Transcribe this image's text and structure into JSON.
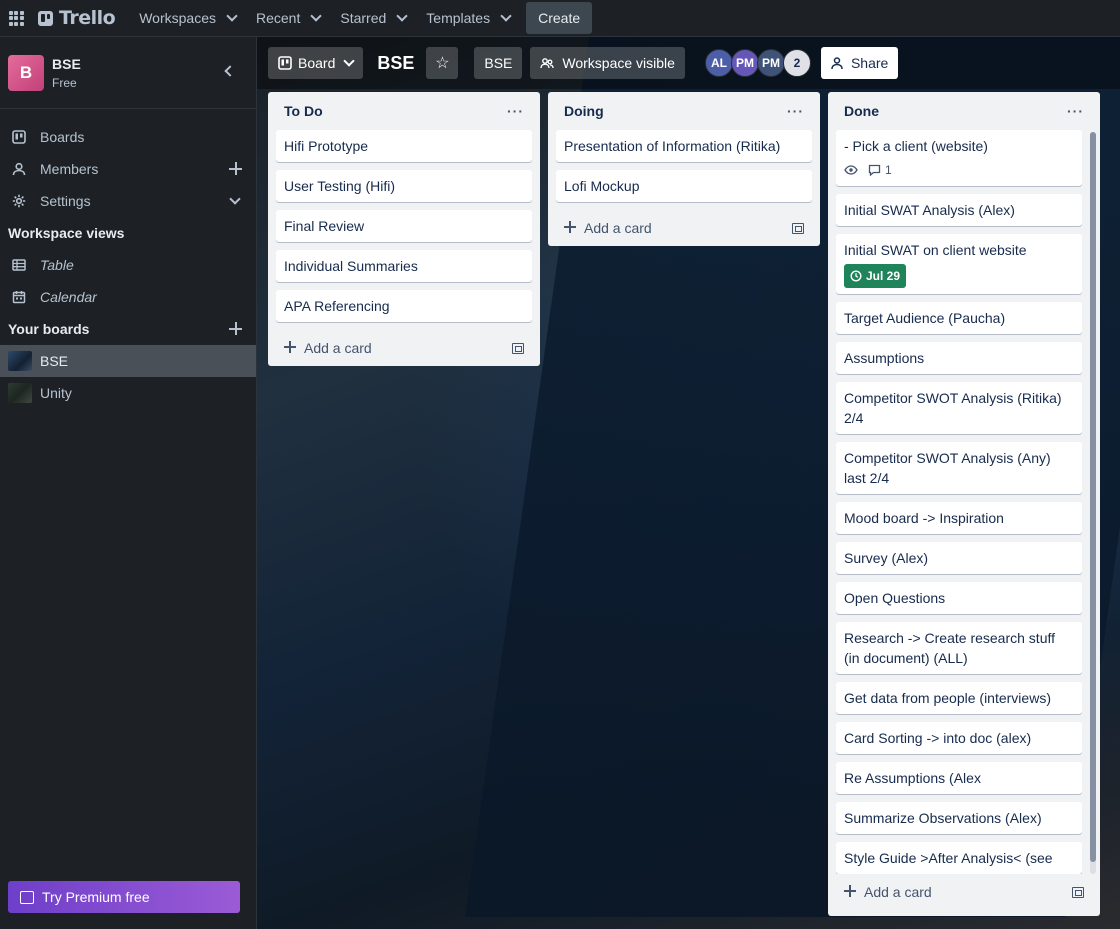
{
  "topnav": {
    "brand": "Trello",
    "menus": [
      "Workspaces",
      "Recent",
      "Starred",
      "Templates"
    ],
    "create_label": "Create"
  },
  "sidebar": {
    "workspace_initial": "B",
    "workspace_name": "BSE",
    "workspace_plan": "Free",
    "items": [
      {
        "label": "Boards",
        "icon": "board-icon"
      },
      {
        "label": "Members",
        "icon": "person-icon"
      },
      {
        "label": "Settings",
        "icon": "gear-icon"
      }
    ],
    "workspace_views_title": "Workspace views",
    "views": [
      {
        "label": "Table",
        "icon": "table-icon"
      },
      {
        "label": "Calendar",
        "icon": "calendar-icon"
      }
    ],
    "your_boards_title": "Your boards",
    "boards": [
      {
        "label": "BSE",
        "active": true
      },
      {
        "label": "Unity",
        "active": false
      }
    ],
    "premium_label": "Try Premium free"
  },
  "board_header": {
    "view_label": "Board",
    "title": "BSE",
    "workspace_label": "BSE",
    "visibility_label": "Workspace visible",
    "members": [
      "AL",
      "PM",
      "PM"
    ],
    "extra_members": "2",
    "share_label": "Share"
  },
  "lists": [
    {
      "title": "To Do",
      "cards": [
        {
          "title": "Hifi Prototype"
        },
        {
          "title": "User Testing (Hifi)"
        },
        {
          "title": "Final Review"
        },
        {
          "title": "Individual Summaries"
        },
        {
          "title": "APA Referencing"
        }
      ],
      "add_label": "Add a card"
    },
    {
      "title": "Doing",
      "cards": [
        {
          "title": "Presentation of Information (Ritika)"
        },
        {
          "title": "Lofi Mockup"
        }
      ],
      "add_label": "Add a card"
    },
    {
      "title": "Done",
      "cards": [
        {
          "title": "- Pick a client (website)",
          "comments": "1",
          "watching": true
        },
        {
          "title": "Initial SWAT Analysis (Alex)"
        },
        {
          "title": "Initial SWAT on client website",
          "due": "Jul 29"
        },
        {
          "title": "Target Audience (Paucha)"
        },
        {
          "title": "Assumptions"
        },
        {
          "title": "Competitor SWOT Analysis (Ritika) 2/4"
        },
        {
          "title": "Competitor SWOT Analysis (Any) last 2/4"
        },
        {
          "title": "Mood board -> Inspiration"
        },
        {
          "title": "Survey (Alex)"
        },
        {
          "title": "Open Questions"
        },
        {
          "title": "Research -> Create research stuff (in document) (ALL)"
        },
        {
          "title": "Get data from people (interviews)"
        },
        {
          "title": "Card Sorting -> into doc (alex)"
        },
        {
          "title": "Re Assumptions (Alex"
        },
        {
          "title": "Summarize Observations (Alex)"
        },
        {
          "title": "Style Guide >After Analysis< (see"
        }
      ],
      "add_label": "Add a card"
    }
  ]
}
